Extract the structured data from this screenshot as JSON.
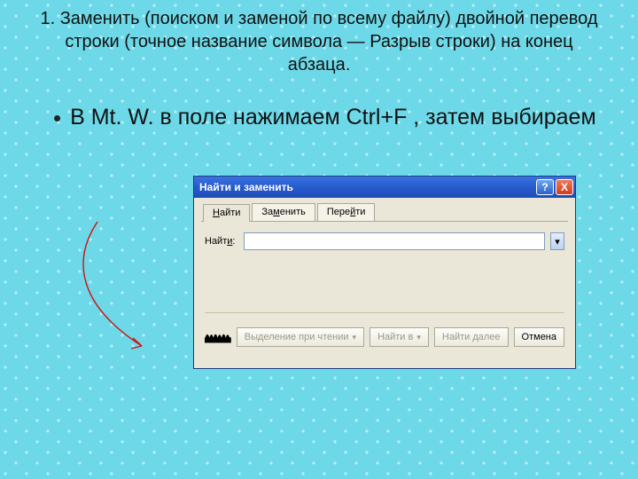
{
  "heading": "1. Заменить (поиском и заменой по всему файлу) двойной перевод строки (точное название символа — Разрыв строки) на конец абзаца.",
  "bullet": {
    "marker": "•",
    "text": "В Mt. W. в поле нажимаем Ctrl+F , затем выбираем"
  },
  "dialog": {
    "title": "Найти и заменить",
    "help_glyph": "?",
    "close_glyph": "X",
    "tabs": {
      "find": {
        "u": "Н",
        "rest": "айти"
      },
      "replace": {
        "pre": "За",
        "u": "м",
        "rest": "енить"
      },
      "goto": {
        "pre": "Пере",
        "u": "й",
        "rest": "ти"
      }
    },
    "field_label": {
      "pre": "Найт",
      "u": "и",
      "suffix": ":"
    },
    "buttons": {
      "highlight": "Выделение при чтении",
      "find_in": "Найти в",
      "find_next": "Найти далее",
      "cancel": "Отмена"
    },
    "dd_glyph": "▾"
  }
}
